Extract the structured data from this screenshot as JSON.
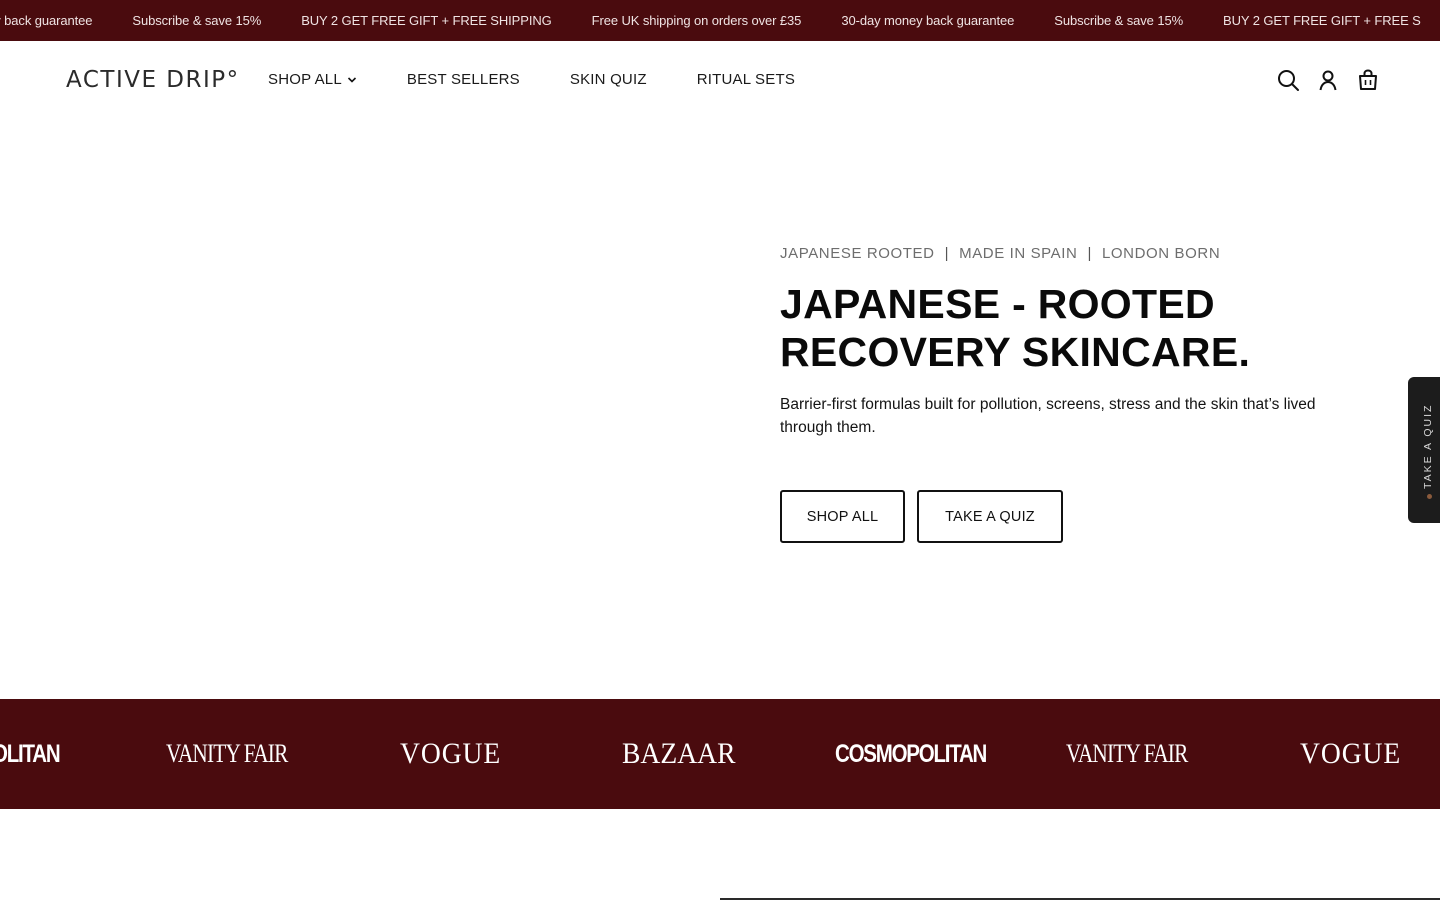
{
  "announcement": {
    "items": [
      "ney back guarantee",
      "Subscribe & save 15%",
      "BUY 2 GET FREE GIFT + FREE SHIPPING",
      "Free UK shipping on orders over £35",
      "30-day money back guarantee",
      "Subscribe & save 15%",
      "BUY 2 GET FREE GIFT + FREE S"
    ]
  },
  "header": {
    "logo": "ACTIVE DRIP°",
    "nav": [
      {
        "label": "SHOP ALL",
        "has_dropdown": true
      },
      {
        "label": "BEST SELLERS"
      },
      {
        "label": "SKIN QUIZ"
      },
      {
        "label": "RITUAL SETS"
      }
    ],
    "icons": [
      "search-icon",
      "account-icon",
      "cart-icon"
    ]
  },
  "hero": {
    "tags": [
      "JAPANESE ROOTED",
      "MADE IN SPAIN",
      "LONDON BORN"
    ],
    "tag_separator": "|",
    "title_lines": [
      "JAPANESE - ROOTED",
      "RECOVERY SKINCARE."
    ],
    "subtitle": "Barrier-first formulas built for pollution, screens, stress and the skin that’s lived through them.",
    "buttons": {
      "shop_all": "SHOP ALL",
      "take_quiz": "TAKE A QUIZ"
    }
  },
  "quiz_tab": {
    "label": "TAKE A QUIZ"
  },
  "press": {
    "logos": [
      "OLITAN",
      "VANITY FAIR",
      "VOGUE",
      "BAZAAR",
      "COSMOPOLITAN",
      "VANITY FAIR",
      "VOGUE"
    ]
  },
  "colors": {
    "brand_dark_red": "#4a0b0e",
    "text": "#111111",
    "tag_gray": "#6d6d6d",
    "quiz_tab_bg": "#1c1c1c"
  }
}
